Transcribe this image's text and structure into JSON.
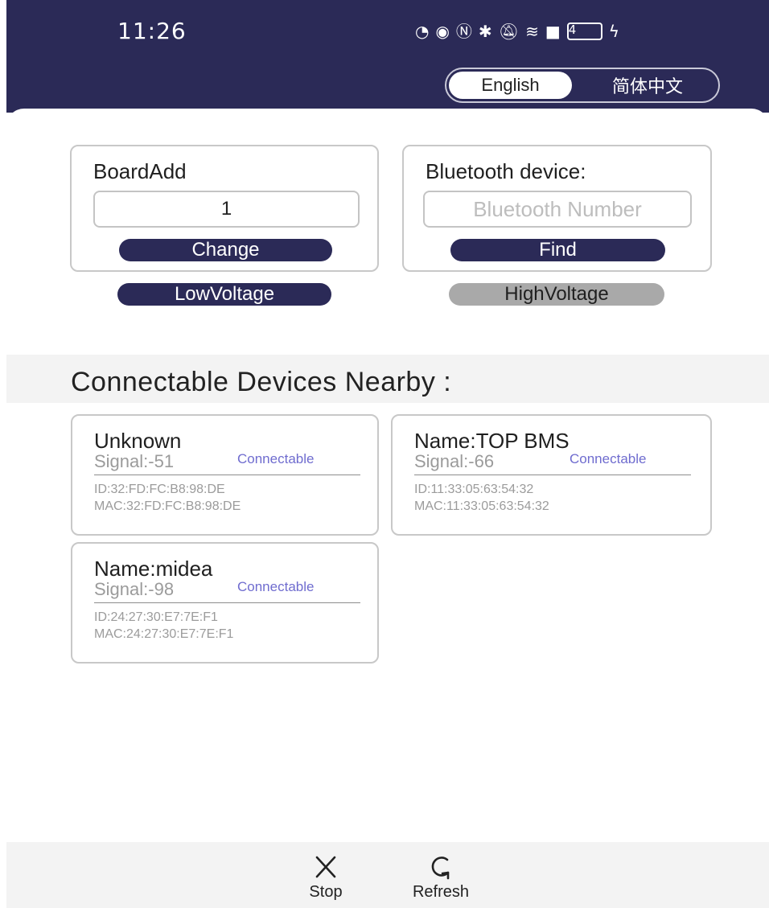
{
  "status_bar": {
    "time": "11:26",
    "battery_level": "4"
  },
  "language": {
    "english": "English",
    "chinese": "简体中文",
    "selected": "English"
  },
  "board": {
    "title": "BoardAdd",
    "value": "1",
    "change_label": "Change"
  },
  "bluetooth": {
    "title": "Bluetooth device:",
    "placeholder": "Bluetooth Number",
    "find_label": "Find"
  },
  "voltage": {
    "low_label": "LowVoltage",
    "high_label": "HighVoltage",
    "selected": "LowVoltage"
  },
  "devices_section": {
    "title": "Connectable Devices Nearby :"
  },
  "devices": [
    {
      "name": "Unknown",
      "signal": "Signal:-51",
      "status": "Connectable",
      "id": "ID:32:FD:FC:B8:98:DE",
      "mac": "MAC:32:FD:FC:B8:98:DE"
    },
    {
      "name": "Name:TOP  BMS",
      "signal": "Signal:-66",
      "status": "Connectable",
      "id": "ID:11:33:05:63:54:32",
      "mac": "MAC:11:33:05:63:54:32"
    },
    {
      "name": "Name:midea",
      "signal": "Signal:-98",
      "status": "Connectable",
      "id": "ID:24:27:30:E7:7E:F1",
      "mac": "MAC:24:27:30:E7:7E:F1"
    }
  ],
  "actions": {
    "stop_label": "Stop",
    "refresh_label": "Refresh"
  },
  "colors": {
    "header": "#2b2a57",
    "accent": "#2b2a57",
    "connectable": "#6f6ccf",
    "inactive_pill": "#a9a9a9"
  }
}
